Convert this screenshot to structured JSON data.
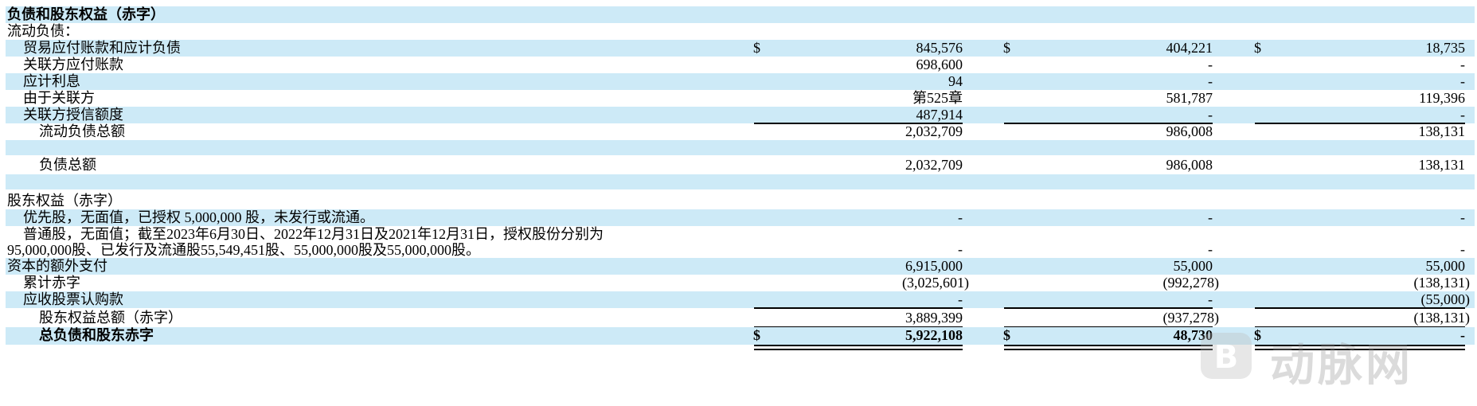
{
  "rows": [
    {
      "label": "负债和股东权益（赤字）",
      "indent": 0,
      "bold": true,
      "shade": true
    },
    {
      "label": "流动负债：",
      "indent": 0,
      "shade": false
    },
    {
      "label": "贸易应付账款和应计负债",
      "indent": 1,
      "shade": true,
      "cur": [
        "$",
        "$",
        "$"
      ],
      "vals": [
        "845,576",
        "404,221",
        "18,735"
      ]
    },
    {
      "label": "关联方应付账款",
      "indent": 1,
      "shade": false,
      "vals": [
        "698,600",
        "-",
        "-"
      ]
    },
    {
      "label": "应计利息",
      "indent": 1,
      "shade": true,
      "vals": [
        "94",
        "-",
        "-"
      ]
    },
    {
      "label": "由于关联方",
      "indent": 1,
      "shade": false,
      "vals": [
        "第525章",
        "581,787",
        "119,396"
      ]
    },
    {
      "label": "关联方授信额度",
      "indent": 1,
      "shade": true,
      "vals": [
        "487,914",
        "-",
        "-"
      ]
    },
    {
      "label": "流动负债总额",
      "indent": 2,
      "shade": false,
      "vals": [
        "2,032,709",
        "986,008",
        "138,131"
      ]
    },
    {
      "label": "负债总额",
      "indent": 2,
      "shade": false,
      "vals": [
        "2,032,709",
        "986,008",
        "138,131"
      ]
    },
    {
      "label": "股东权益（赤字）",
      "indent": 0,
      "shade": false
    },
    {
      "label": "优先股，无面值，已授权 5,000,000 股，未发行或流通。",
      "indent": 1,
      "shade": true,
      "vals": [
        "-",
        "-",
        "-"
      ]
    },
    {
      "label_lines": [
        "普通股，无面值；截至2023年6月30日、2022年12月31日及2021年12月31日，授权股份分别为",
        "95,000,000股、已发行及流通股55,549,451股、55,000,000股及55,000,000股。"
      ],
      "shade": false,
      "vals": [
        "-",
        "-",
        "-"
      ]
    },
    {
      "label": "资本的额外支付",
      "indent": 0,
      "shade": true,
      "vals": [
        "6,915,000",
        "55,000",
        "55,000"
      ]
    },
    {
      "label": "累计赤字",
      "indent": 1,
      "shade": false,
      "vals": [
        "(3,025,601)",
        "(992,278)",
        "(138,131)"
      ]
    },
    {
      "label": "应收股票认购款",
      "indent": 1,
      "shade": true,
      "vals": [
        "-",
        "-",
        "(55,000)"
      ]
    },
    {
      "label": "股东权益总额（赤字）",
      "indent": 2,
      "shade": false,
      "vals": [
        "3,889,399",
        "(937,278)",
        "(138,131)"
      ]
    },
    {
      "label": "总负债和股东赤字",
      "indent": 2,
      "bold": true,
      "shade": true,
      "cur": [
        "$",
        "$",
        "$"
      ],
      "vals": [
        "5,922,108",
        "48,730",
        "-"
      ]
    }
  ],
  "watermark": {
    "text": "动脉网",
    "logo_letter": "B"
  }
}
